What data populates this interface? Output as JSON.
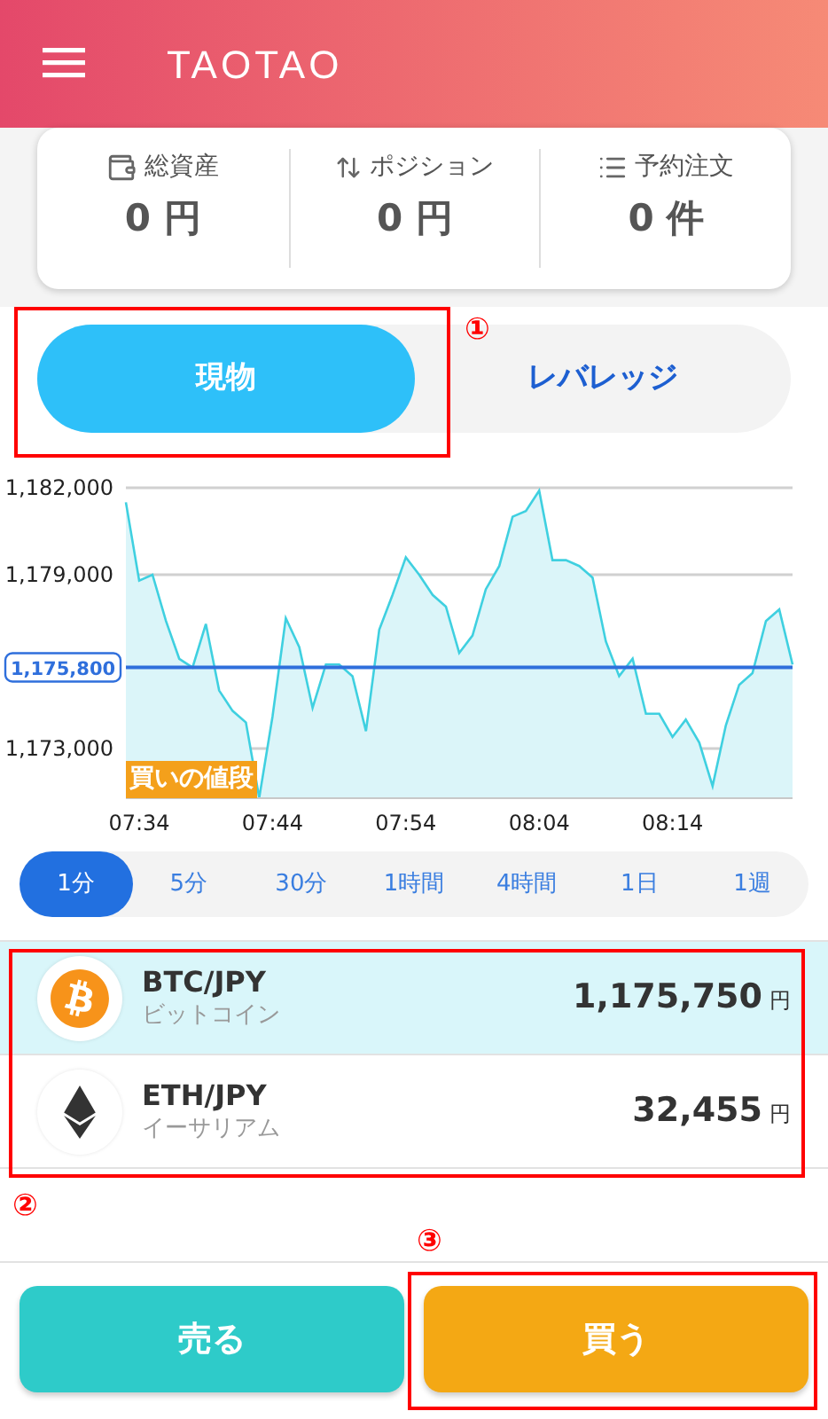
{
  "header": {
    "logo": "TAOTAO"
  },
  "summary": [
    {
      "kind": "wallet",
      "label": "総資産",
      "value": "0 円"
    },
    {
      "kind": "position",
      "label": "ポジション",
      "value": "0 円"
    },
    {
      "kind": "orders",
      "label": "予約注文",
      "value": "0 件"
    }
  ],
  "mode_tabs": [
    {
      "label": "現物",
      "selected": true
    },
    {
      "label": "レバレッジ",
      "selected": false
    }
  ],
  "chart": {
    "chart_data": {
      "type": "area",
      "categories": [
        null,
        "07:34",
        null,
        null,
        null,
        null,
        null,
        null,
        null,
        null,
        null,
        "07:44",
        null,
        null,
        null,
        null,
        null,
        null,
        null,
        null,
        null,
        "07:54",
        null,
        null,
        null,
        null,
        null,
        null,
        null,
        null,
        null,
        "08:04",
        null,
        null,
        null,
        null,
        null,
        null,
        null,
        null,
        null,
        "08:14",
        null,
        null,
        null,
        null,
        null,
        null,
        null,
        null,
        null
      ],
      "series": [
        {
          "color": "#3fd0e0",
          "values": [
            1181500,
            1178800,
            1179000,
            1177400,
            1176100,
            1175800,
            1177300,
            1175000,
            1174300,
            1173900,
            1171300,
            1174100,
            1177500,
            1176500,
            1174400,
            1175900,
            1175900,
            1175500,
            1173600,
            1177100,
            1178300,
            1179600,
            1179000,
            1178300,
            1177900,
            1176300,
            1176900,
            1178500,
            1179300,
            1181000,
            1181200,
            1181900,
            1179500,
            1179500,
            1179300,
            1178900,
            1176700,
            1175500,
            1176100,
            1174200,
            1174200,
            1173400,
            1174000,
            1173200,
            1171700,
            1173800,
            1175200,
            1175600,
            1177400,
            1177800,
            1175900
          ]
        }
      ],
      "yticks": [
        {
          "value": 1182000,
          "label": "1,182,000"
        },
        {
          "value": 1179000,
          "label": "1,179,000"
        },
        {
          "value": 1175800,
          "label": "1,175,800"
        },
        {
          "value": 1173000,
          "label": "1,173,000"
        }
      ],
      "ylim": [
        1171286,
        1182000
      ],
      "grid": true,
      "ref_lines": [
        {
          "axis": "y",
          "value": 1175800,
          "color": "#2f6fdc"
        }
      ]
    },
    "price_label": "買いの値段"
  },
  "timeframes": [
    {
      "label": "1分",
      "selected": true
    },
    {
      "label": "5分",
      "selected": false
    },
    {
      "label": "30分",
      "selected": false
    },
    {
      "label": "1時間",
      "selected": false
    },
    {
      "label": "4時間",
      "selected": false
    },
    {
      "label": "1日",
      "selected": false
    },
    {
      "label": "1週",
      "selected": false
    }
  ],
  "coins": [
    {
      "kind": "bitcoin",
      "pair": "BTC/JPY",
      "name": "ビットコイン",
      "price": "1,175,750",
      "unit": "円",
      "selected": true
    },
    {
      "kind": "ethereum",
      "pair": "ETH/JPY",
      "name": "イーサリアム",
      "price": "32,455",
      "unit": "円",
      "selected": false
    }
  ],
  "actions": [
    {
      "kind": "sell",
      "label": "売る"
    },
    {
      "kind": "buy",
      "label": "買う"
    }
  ],
  "callouts": [
    "①",
    "②",
    "③"
  ]
}
